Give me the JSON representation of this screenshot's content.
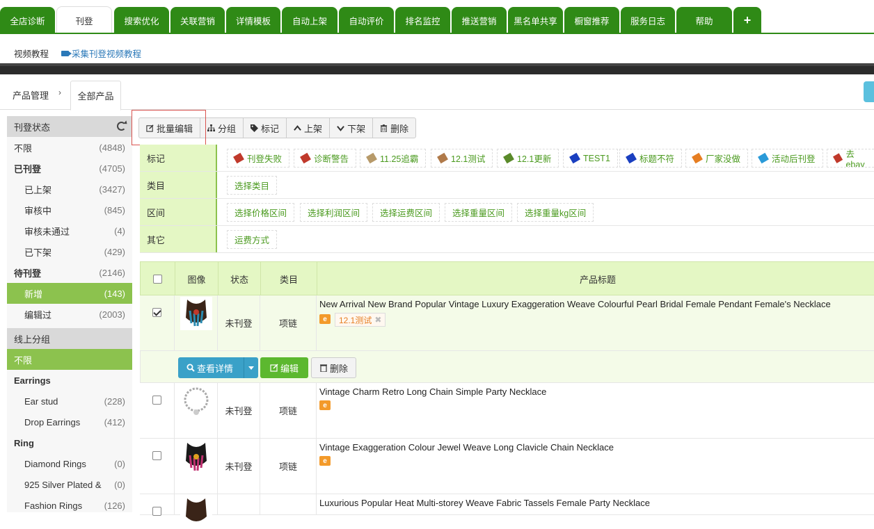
{
  "nav": {
    "tabs": [
      "全店诊断",
      "刊登",
      "搜索优化",
      "关联营销",
      "详情模板",
      "自动上架",
      "自动评价",
      "排名监控",
      "推送营销",
      "黑名单共享",
      "橱窗推荐",
      "服务日志",
      "帮助",
      "+"
    ],
    "active_tab": "刊登"
  },
  "subnav": {
    "video_label": "视频教程",
    "video_link": "采集刊登视频教程"
  },
  "breadcrumb": {
    "root": "产品管理",
    "sep": "›",
    "current": "全部产品"
  },
  "sidebar": {
    "status_header": "刊登状态",
    "items": [
      {
        "label": "不限",
        "count": "(4848)"
      },
      {
        "label": "已刊登",
        "count": "(4705)"
      },
      {
        "label": "已上架",
        "count": "(3427)"
      },
      {
        "label": "审核中",
        "count": "(845)"
      },
      {
        "label": "审核未通过",
        "count": "(4)"
      },
      {
        "label": "已下架",
        "count": "(429)"
      },
      {
        "label": "待刊登",
        "count": "(2146)"
      },
      {
        "label": "新增",
        "count": "(143)"
      },
      {
        "label": "编辑过",
        "count": "(2003)"
      }
    ],
    "group_header": "线上分组",
    "group_items": [
      {
        "label": "不限",
        "count": ""
      },
      {
        "label": "Earrings",
        "count": ""
      },
      {
        "label": "Ear stud",
        "count": "(228)"
      },
      {
        "label": "Drop Earrings",
        "count": "(412)"
      },
      {
        "label": "Ring",
        "count": ""
      },
      {
        "label": "Diamond Rings",
        "count": "(0)"
      },
      {
        "label": "925 Silver Plated &",
        "count": "(0)"
      },
      {
        "label": "Fashion Rings",
        "count": "(126)"
      }
    ]
  },
  "toolbar": {
    "batch_edit": "批量编辑",
    "group": "分组",
    "mark": "标记",
    "list_on": "上架",
    "list_off": "下架",
    "delete": "删除"
  },
  "filters": {
    "mark_label": "标记",
    "marks": [
      {
        "label": "刊登失败",
        "color": "#c0392b"
      },
      {
        "label": "诊断警告",
        "color": "#c0392b"
      },
      {
        "label": "11.25追霸",
        "color": "#b79a6a"
      },
      {
        "label": "12.1测试",
        "color": "#b07a4a"
      },
      {
        "label": "12.1更新",
        "color": "#5a8a2a"
      },
      {
        "label": "TEST1",
        "color": "#1a3fc0"
      },
      {
        "label": "标题不符",
        "color": "#1a3fc0"
      },
      {
        "label": "厂家没做",
        "color": "#e67e22"
      },
      {
        "label": "活动后刊登",
        "color": "#2a9ad8"
      },
      {
        "label": "去ebay",
        "color": "#c0392b"
      }
    ],
    "category_label": "类目",
    "category_chip": "选择类目",
    "range_label": "区间",
    "range_chips": [
      "选择价格区间",
      "选择利润区间",
      "选择运费区间",
      "选择重量区间",
      "选择重量kg区间"
    ],
    "other_label": "其它",
    "other_chip": "运费方式"
  },
  "table": {
    "headers": {
      "image": "图像",
      "status": "状态",
      "category": "类目",
      "title": "产品标题"
    },
    "rows": [
      {
        "status": "未刊登",
        "category": "项链",
        "title": "New Arrival New Brand Popular Vintage Luxury Exaggeration Weave Colourful Pearl Bridal Female Pendant Female's Necklace",
        "tag": "12.1测试",
        "checked": true
      },
      {
        "status": "未刊登",
        "category": "项链",
        "title": "Vintage Charm Retro Long Chain Simple Party Necklace",
        "checked": false
      },
      {
        "status": "未刊登",
        "category": "项链",
        "title": "Vintage Exaggeration Colour Jewel Weave Long Clavicle Chain Necklace",
        "checked": false
      },
      {
        "status": "",
        "category": "",
        "title": "Luxurious Popular Heat Multi-storey Weave Fabric Tassels Female Party Necklace",
        "checked": false
      }
    ],
    "actions": {
      "view": "查看详情",
      "edit": "编辑",
      "delete": "删除"
    }
  },
  "colors": {
    "nav_green": "#2f8a16",
    "accent_green": "#8cc24e",
    "info_blue": "#3aa1c8",
    "light_green": "#e4f7c4"
  }
}
